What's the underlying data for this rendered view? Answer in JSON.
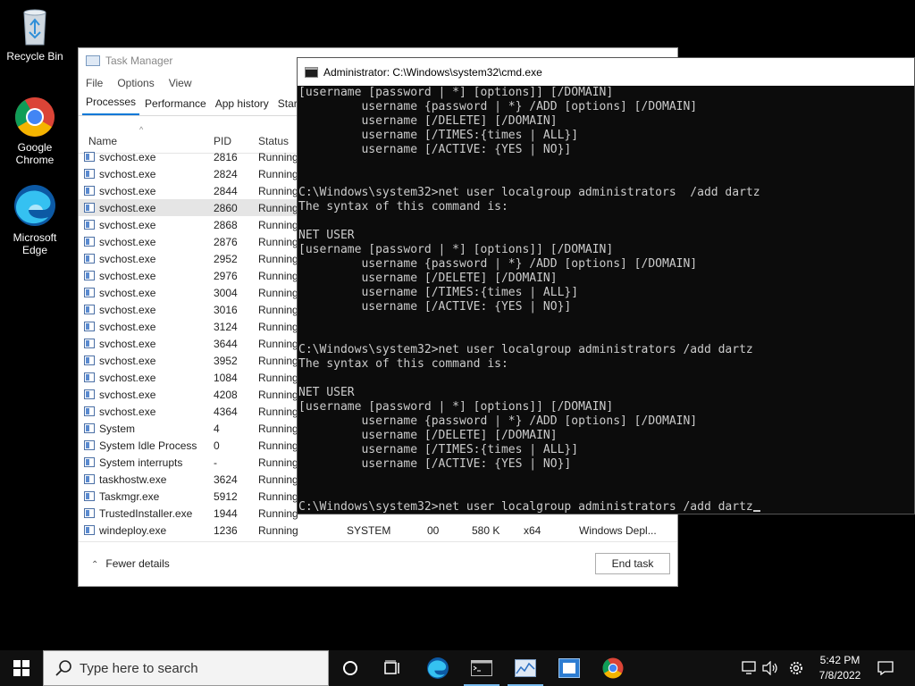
{
  "desktop": {
    "icons": [
      {
        "label": "Recycle Bin"
      },
      {
        "label": "Google Chrome"
      },
      {
        "label": "Microsoft Edge"
      }
    ]
  },
  "taskmgr": {
    "title": "Task Manager",
    "menu": [
      "File",
      "Options",
      "View"
    ],
    "tabs": [
      "Processes",
      "Performance",
      "App history",
      "Star"
    ],
    "columns": {
      "name": "Name",
      "pid": "PID",
      "status": "Status"
    },
    "rows": [
      {
        "name": "svchost.exe",
        "pid": "2816",
        "status": "Running"
      },
      {
        "name": "svchost.exe",
        "pid": "2824",
        "status": "Running"
      },
      {
        "name": "svchost.exe",
        "pid": "2844",
        "status": "Running"
      },
      {
        "name": "svchost.exe",
        "pid": "2860",
        "status": "Running"
      },
      {
        "name": "svchost.exe",
        "pid": "2868",
        "status": "Running"
      },
      {
        "name": "svchost.exe",
        "pid": "2876",
        "status": "Running"
      },
      {
        "name": "svchost.exe",
        "pid": "2952",
        "status": "Running"
      },
      {
        "name": "svchost.exe",
        "pid": "2976",
        "status": "Running"
      },
      {
        "name": "svchost.exe",
        "pid": "3004",
        "status": "Running"
      },
      {
        "name": "svchost.exe",
        "pid": "3016",
        "status": "Running"
      },
      {
        "name": "svchost.exe",
        "pid": "3124",
        "status": "Running"
      },
      {
        "name": "svchost.exe",
        "pid": "3644",
        "status": "Running"
      },
      {
        "name": "svchost.exe",
        "pid": "3952",
        "status": "Running"
      },
      {
        "name": "svchost.exe",
        "pid": "1084",
        "status": "Running"
      },
      {
        "name": "svchost.exe",
        "pid": "4208",
        "status": "Running"
      },
      {
        "name": "svchost.exe",
        "pid": "4364",
        "status": "Running"
      },
      {
        "name": "System",
        "pid": "4",
        "status": "Running"
      },
      {
        "name": "System Idle Process",
        "pid": "0",
        "status": "Running"
      },
      {
        "name": "System interrupts",
        "pid": "-",
        "status": "Running"
      },
      {
        "name": "taskhostw.exe",
        "pid": "3624",
        "status": "Running"
      },
      {
        "name": "Taskmgr.exe",
        "pid": "5912",
        "status": "Running"
      },
      {
        "name": "TrustedInstaller.exe",
        "pid": "1944",
        "status": "Running"
      },
      {
        "name": "windeploy.exe",
        "pid": "1236",
        "status": "Running",
        "user": "SYSTEM",
        "cpu": "00",
        "memory": "580 K",
        "arch": "x64",
        "description": "Windows Depl..."
      }
    ],
    "selected_row": 3,
    "fewer_details": "Fewer details",
    "end_task": "End task"
  },
  "cmd": {
    "title": "Administrator: C:\\Windows\\system32\\cmd.exe",
    "lines": [
      "[username [password | *] [options]] [/DOMAIN]",
      "         username {password | *} /ADD [options] [/DOMAIN]",
      "         username [/DELETE] [/DOMAIN]",
      "         username [/TIMES:{times | ALL}]",
      "         username [/ACTIVE: {YES | NO}]",
      "",
      "",
      "C:\\Windows\\system32>net user localgroup administrators  /add dartz",
      "The syntax of this command is:",
      "",
      "NET USER",
      "[username [password | *] [options]] [/DOMAIN]",
      "         username {password | *} /ADD [options] [/DOMAIN]",
      "         username [/DELETE] [/DOMAIN]",
      "         username [/TIMES:{times | ALL}]",
      "         username [/ACTIVE: {YES | NO}]",
      "",
      "",
      "C:\\Windows\\system32>net user localgroup administrators /add dartz",
      "The syntax of this command is:",
      "",
      "NET USER",
      "[username [password | *] [options]] [/DOMAIN]",
      "         username {password | *} /ADD [options] [/DOMAIN]",
      "         username [/DELETE] [/DOMAIN]",
      "         username [/TIMES:{times | ALL}]",
      "         username [/ACTIVE: {YES | NO}]",
      "",
      "",
      "C:\\Windows\\system32>net user localgroup administrators /add dartz"
    ]
  },
  "taskbar": {
    "search_placeholder": "Type here to search",
    "time": "5:42 PM",
    "date": "7/8/2022",
    "pinned": [
      "windows-start",
      "search",
      "task-view",
      "microsoft-edge",
      "command-prompt",
      "task-manager",
      "file-explorer",
      "google-chrome"
    ],
    "tray": [
      "network-icon",
      "volume-icon",
      "settings-icon",
      "notification-icon"
    ]
  }
}
